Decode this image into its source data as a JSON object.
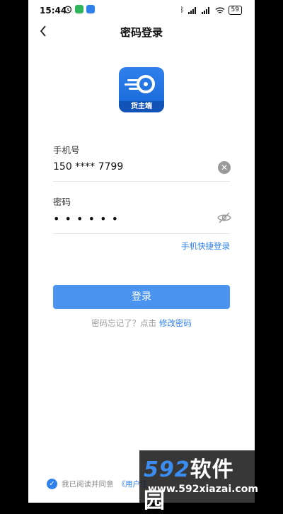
{
  "status_bar": {
    "time": "15:44",
    "battery": "59"
  },
  "header": {
    "title": "密码登录"
  },
  "logo": {
    "label": "货主端"
  },
  "form": {
    "phone_label": "手机号",
    "phone_value": "150 **** 7799",
    "password_label": "密码",
    "password_value": "• • • • • •",
    "quick_login": "手机快捷登录"
  },
  "login_button": "登录",
  "forgot": {
    "text": "密码忘记了？点击",
    "link": "修改密码"
  },
  "agreement": {
    "text": "我已阅读并同意",
    "link": "《用户注"
  },
  "watermark": {
    "brand_num": "592",
    "brand_cn": "软件园",
    "url": "www.592xiazai.com"
  },
  "colors": {
    "accent": "#2f80ed",
    "button": "#4a94f0"
  }
}
